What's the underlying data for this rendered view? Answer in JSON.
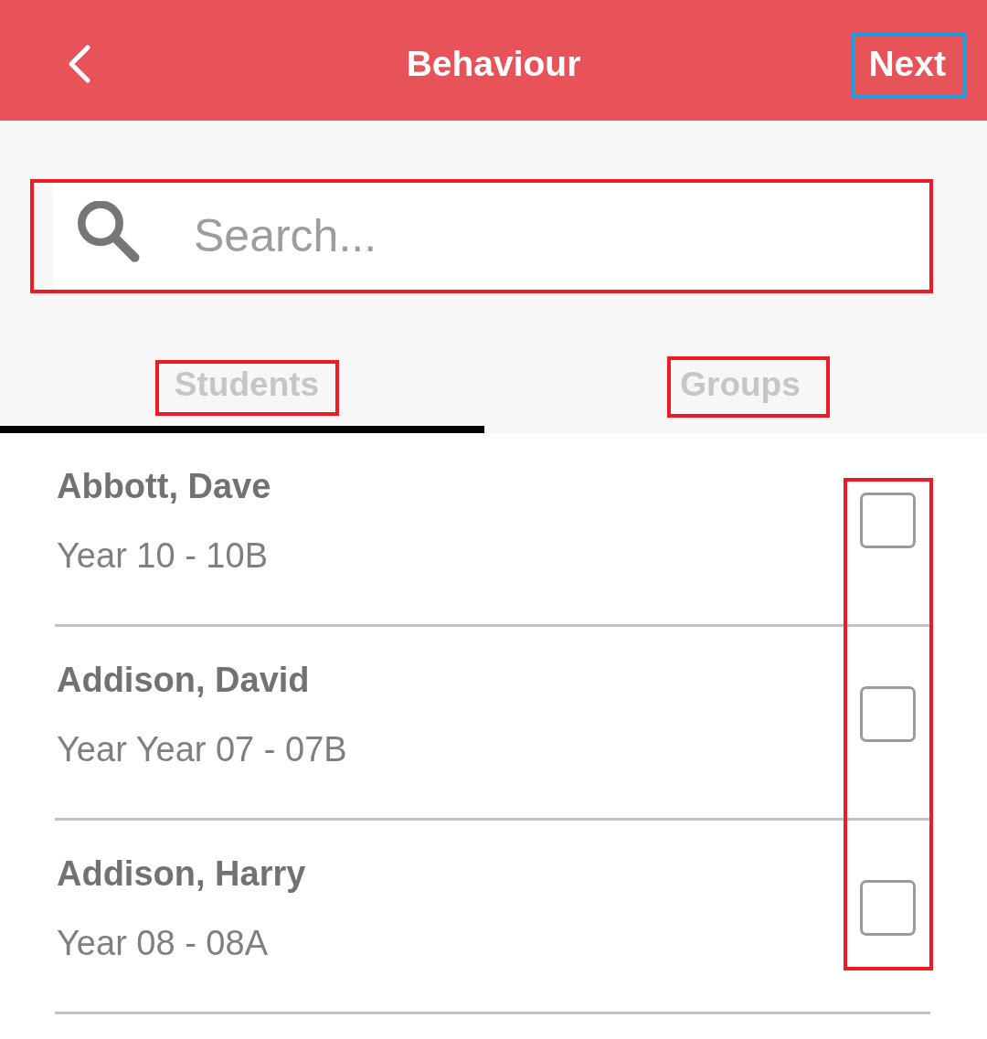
{
  "header": {
    "title": "Behaviour",
    "next_button": "Next"
  },
  "search": {
    "placeholder": "Search..."
  },
  "tabs": [
    {
      "label": "Students",
      "selected": true
    },
    {
      "label": "Groups",
      "selected": false
    }
  ],
  "students": [
    {
      "name": "Abbott, Dave",
      "class": "Year 10 - 10B",
      "checked": false
    },
    {
      "name": "Addison, David",
      "class": "Year Year 07 - 07B",
      "checked": false
    },
    {
      "name": "Addison, Harry",
      "class": "Year 08 - 08A",
      "checked": false
    }
  ]
}
